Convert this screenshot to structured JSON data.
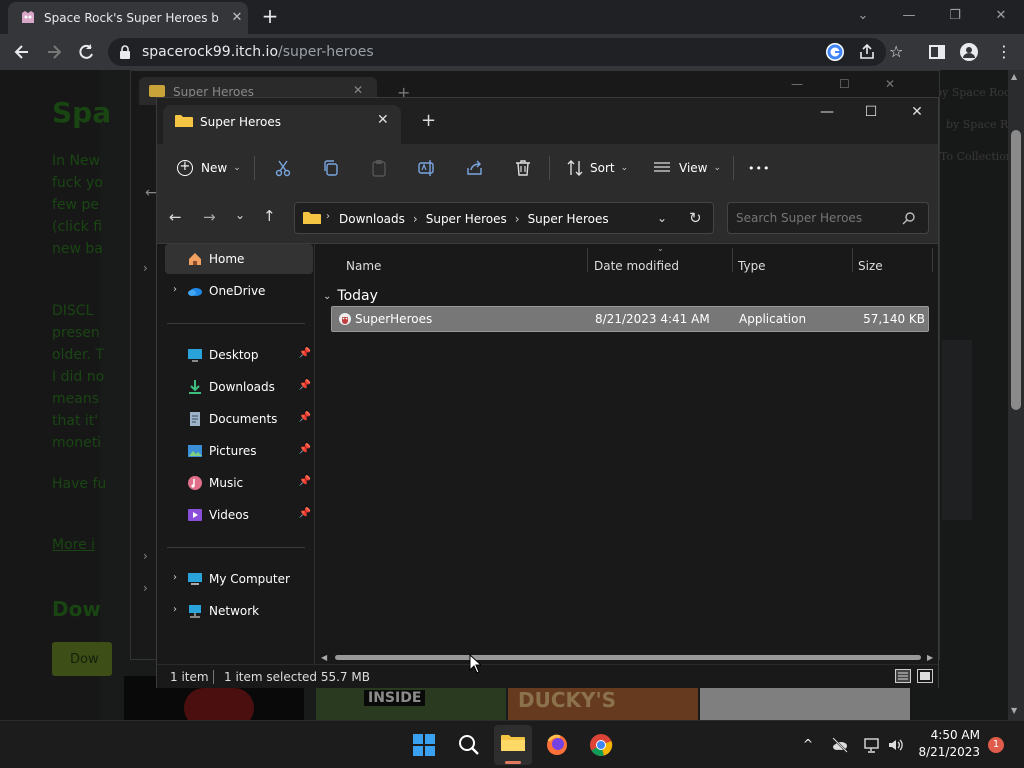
{
  "browser": {
    "tab_title": "Space Rock's Super Heroes by Space Rock",
    "url_host": "spacerock99.itch.io",
    "url_path": "/super-heroes"
  },
  "page": {
    "title_fragment": "Spa",
    "para1": [
      "In New",
      "fuck yo",
      "few pe",
      "(click fi",
      "new ba"
    ],
    "para2": [
      "DISCL",
      "presen",
      "older. T",
      "I did no",
      "means",
      "that it'",
      "moneti"
    ],
    "have_fun": "Have fu",
    "more_info": "More i",
    "download_fragment": "Dow",
    "download_btn": "Dow",
    "right_links": [
      "all by Space Rock",
      "by Space Rock",
      "To Collection"
    ],
    "thumb_labels": [
      "INSIDE",
      "DUCKY'S"
    ]
  },
  "bg_explorer": {
    "tab_title": "Super Heroes"
  },
  "explorer": {
    "tab_title": "Super Heroes",
    "toolbar": {
      "new_label": "New",
      "sort_label": "Sort",
      "view_label": "View",
      "more_label": "•••"
    },
    "breadcrumb": [
      "Downloads",
      "Super Heroes",
      "Super Heroes"
    ],
    "search_placeholder": "Search Super Heroes",
    "nav": {
      "home": "Home",
      "onedrive": "OneDrive",
      "desktop": "Desktop",
      "downloads": "Downloads",
      "documents": "Documents",
      "pictures": "Pictures",
      "music": "Music",
      "videos": "Videos",
      "my_computer": "My Computer",
      "network": "Network"
    },
    "columns": {
      "name": "Name",
      "date": "Date modified",
      "type": "Type",
      "size": "Size"
    },
    "group_label": "Today",
    "file": {
      "name": "SuperHeroes",
      "date": "8/21/2023 4:41 AM",
      "type": "Application",
      "size": "57,140 KB"
    },
    "status": {
      "count": "1 item",
      "selected": "1 item selected  55.7 MB"
    }
  },
  "taskbar": {
    "time": "4:50 AM",
    "date": "8/21/2023",
    "notif_count": "1"
  },
  "colors": {
    "accent_green": "#2f7f22",
    "folder_yellow": "#f4c542",
    "selection": "#777777"
  }
}
